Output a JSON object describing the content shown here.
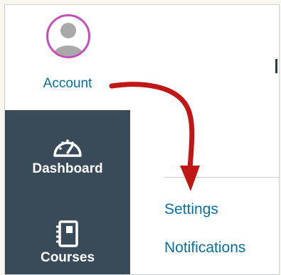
{
  "account": {
    "label": "Account",
    "avatar_ring_color": "#c54cbd"
  },
  "nav": {
    "background": "#394b58",
    "items": [
      {
        "label": "Dashboard",
        "icon": "dashboard-gauge-icon"
      },
      {
        "label": "Courses",
        "icon": "courses-notebook-icon"
      }
    ]
  },
  "menu": {
    "link_color": "#0770a3",
    "items": [
      {
        "label": "Settings"
      },
      {
        "label": "Notifications"
      }
    ]
  },
  "annotation": {
    "arrow_color": "#c01616"
  }
}
